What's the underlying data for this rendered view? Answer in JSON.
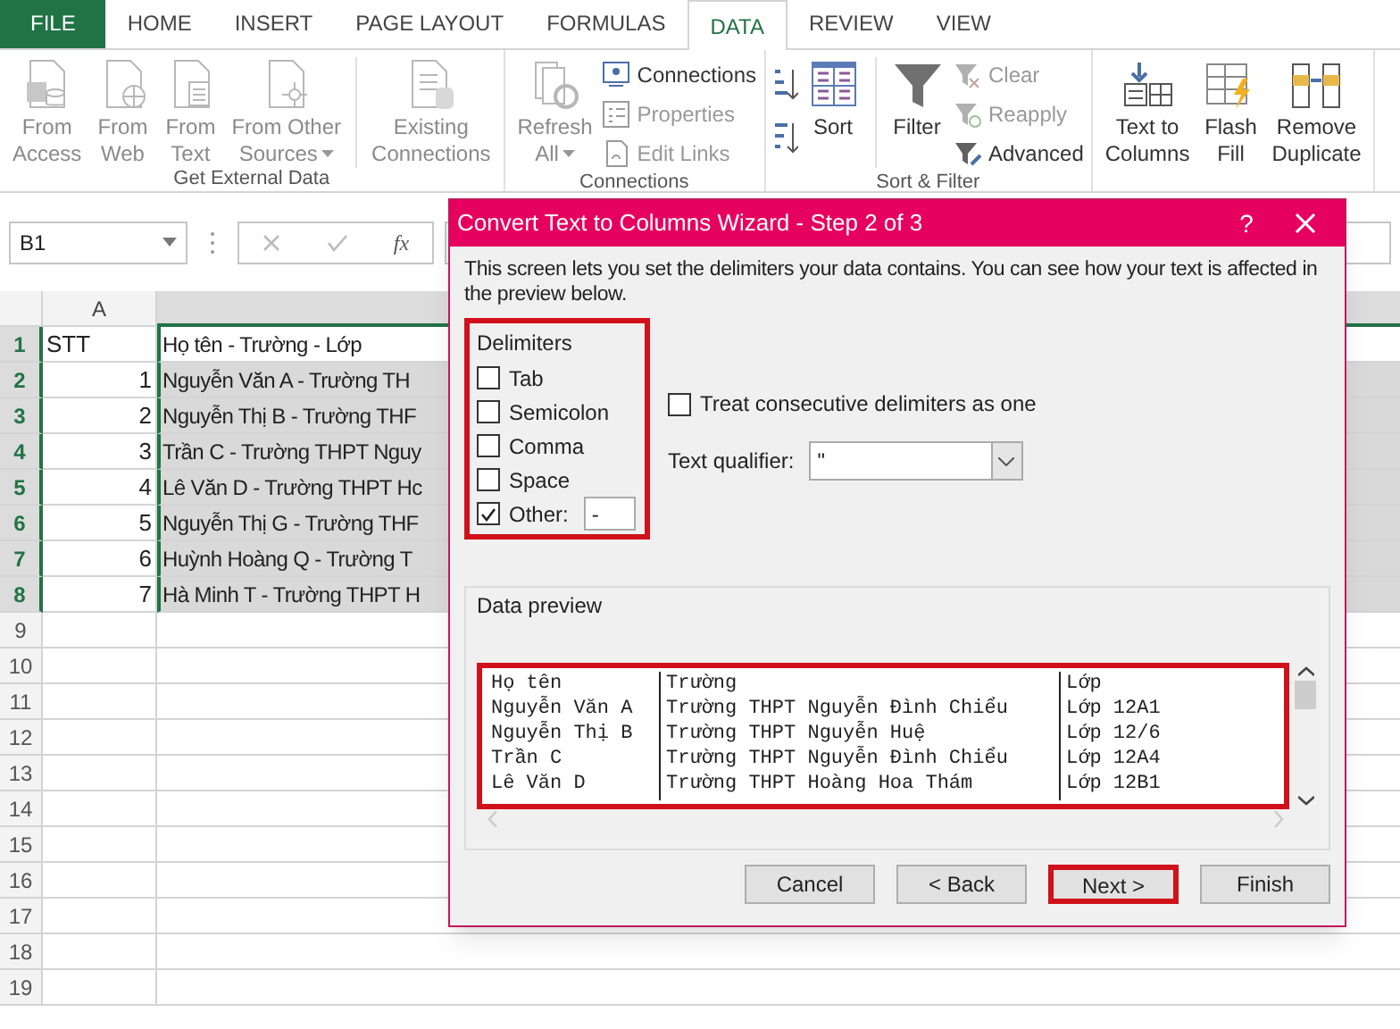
{
  "ribbon_tabs": [
    {
      "label": "FILE",
      "kind": "file",
      "selected": false
    },
    {
      "label": "HOME",
      "kind": "tab",
      "selected": false
    },
    {
      "label": "INSERT",
      "kind": "tab",
      "selected": false
    },
    {
      "label": "PAGE LAYOUT",
      "kind": "tab",
      "selected": false
    },
    {
      "label": "FORMULAS",
      "kind": "tab",
      "selected": false
    },
    {
      "label": "DATA",
      "kind": "tab",
      "selected": true
    },
    {
      "label": "REVIEW",
      "kind": "tab",
      "selected": false
    },
    {
      "label": "VIEW",
      "kind": "tab",
      "selected": false
    }
  ],
  "ribbon_groups": [
    {
      "label": "Get External Data",
      "items": [
        {
          "kind": "large",
          "lines": [
            "From",
            "Access"
          ],
          "disabled": true
        },
        {
          "kind": "large",
          "lines": [
            "From",
            "Web"
          ],
          "disabled": true
        },
        {
          "kind": "large",
          "lines": [
            "From",
            "Text"
          ],
          "disabled": true
        },
        {
          "kind": "large",
          "lines": [
            "From Other",
            "Sources"
          ],
          "dropdown": true,
          "disabled": true
        },
        {
          "kind": "divider"
        },
        {
          "kind": "large",
          "lines": [
            "Existing",
            "Connections"
          ],
          "disabled": true
        }
      ]
    },
    {
      "label": "Connections",
      "items": [
        {
          "kind": "large",
          "lines": [
            "Refresh",
            "All"
          ],
          "dropdown": true,
          "disabled": true
        },
        {
          "kind": "stack",
          "items": [
            {
              "label": "Connections",
              "disabled": false
            },
            {
              "label": "Properties",
              "disabled": true
            },
            {
              "label": "Edit Links",
              "disabled": true
            }
          ]
        }
      ]
    },
    {
      "label": "Sort & Filter",
      "items": [
        {
          "kind": "sortpair"
        },
        {
          "kind": "large",
          "lines": [
            "Sort"
          ],
          "disabled": false
        },
        {
          "kind": "divider"
        },
        {
          "kind": "large",
          "lines": [
            "Filter"
          ],
          "disabled": false
        },
        {
          "kind": "stack",
          "items": [
            {
              "label": "Clear",
              "disabled": true
            },
            {
              "label": "Reapply",
              "disabled": true
            },
            {
              "label": "Advanced",
              "disabled": false
            }
          ]
        }
      ]
    },
    {
      "items": [
        {
          "kind": "large",
          "lines": [
            "Text to",
            "Columns"
          ],
          "disabled": false
        },
        {
          "kind": "large",
          "lines": [
            "Flash",
            "Fill"
          ],
          "disabled": false
        },
        {
          "kind": "large",
          "lines": [
            "Remove",
            "Duplicate"
          ],
          "disabled": false
        }
      ]
    }
  ],
  "formula_bar": {
    "name_box": "B1",
    "function_label": "fx"
  },
  "sheet": {
    "columns": [
      "A"
    ],
    "rows": [
      {
        "number": "1",
        "a": "STT",
        "b": "Họ tên - Trường - Lớp",
        "selected": true,
        "active": true
      },
      {
        "number": "2",
        "a": "1",
        "b": "Nguyễn Văn A - Trường TH",
        "selected": true,
        "active": false
      },
      {
        "number": "3",
        "a": "2",
        "b": "Nguyễn Thị B - Trường THF",
        "selected": true,
        "active": false
      },
      {
        "number": "4",
        "a": "3",
        "b": "Trần C - Trường THPT Nguy",
        "selected": true,
        "active": false
      },
      {
        "number": "5",
        "a": "4",
        "b": "Lê Văn D - Trường THPT Hc",
        "selected": true,
        "active": false
      },
      {
        "number": "6",
        "a": "5",
        "b": "Nguyễn Thị G - Trường THF",
        "selected": true,
        "active": false
      },
      {
        "number": "7",
        "a": "6",
        "b": "Huỳnh Hoàng Q - Trường T",
        "selected": true,
        "active": false
      },
      {
        "number": "8",
        "a": "7",
        "b": "Hà Minh T - Trường THPT H",
        "selected": true,
        "active": false
      },
      {
        "number": "9",
        "selected": false
      },
      {
        "number": "10",
        "selected": false
      },
      {
        "number": "11",
        "selected": false
      },
      {
        "number": "12",
        "selected": false
      },
      {
        "number": "13",
        "selected": false
      },
      {
        "number": "14",
        "selected": false
      },
      {
        "number": "15",
        "selected": false
      },
      {
        "number": "16",
        "selected": false
      },
      {
        "number": "17",
        "selected": false
      },
      {
        "number": "18",
        "selected": false
      },
      {
        "number": "19",
        "selected": false
      }
    ]
  },
  "dialog": {
    "title": "Convert Text to Columns Wizard - Step 2 of 3",
    "help": "?",
    "description": "This screen lets you set the delimiters your data contains.  You can see how your text is affected in the preview below.",
    "delimiters": {
      "label": "Delimiters",
      "highlighted": true,
      "options": [
        {
          "label": "Tab",
          "checked": false
        },
        {
          "label": "Semicolon",
          "checked": false
        },
        {
          "label": "Comma",
          "checked": false
        },
        {
          "label": "Space",
          "checked": false
        },
        {
          "label": "Other:",
          "checked": true
        }
      ],
      "other_field": {
        "value": "-"
      }
    },
    "consecutive": {
      "label": "Treat consecutive delimiters as one",
      "checked": false
    },
    "text_qualifier": {
      "label": "Text qualifier:",
      "value": "\""
    },
    "preview": {
      "label": "Data preview",
      "highlighted": true,
      "rows": [
        [
          "Họ tên",
          "Trường",
          "Lớp"
        ],
        [
          "Nguyễn Văn A",
          "Trường THPT Nguyễn Đình Chiểu",
          "Lớp 12A1"
        ],
        [
          "Nguyễn Thị B",
          "Trường THPT Nguyễn Huệ",
          "Lớp 12/6"
        ],
        [
          "Trần C",
          "Trường THPT Nguyễn Đình Chiểu",
          "Lớp 12A4"
        ],
        [
          "Lê Văn D",
          "Trường THPT Hoàng Hoa Thám",
          "Lớp 12B1"
        ]
      ]
    },
    "buttons": [
      {
        "label": "Cancel",
        "highlighted": false
      },
      {
        "label": "< Back",
        "highlighted": false
      },
      {
        "label": "Next >",
        "highlighted": true
      },
      {
        "label": "Finish",
        "highlighted": false
      }
    ]
  }
}
